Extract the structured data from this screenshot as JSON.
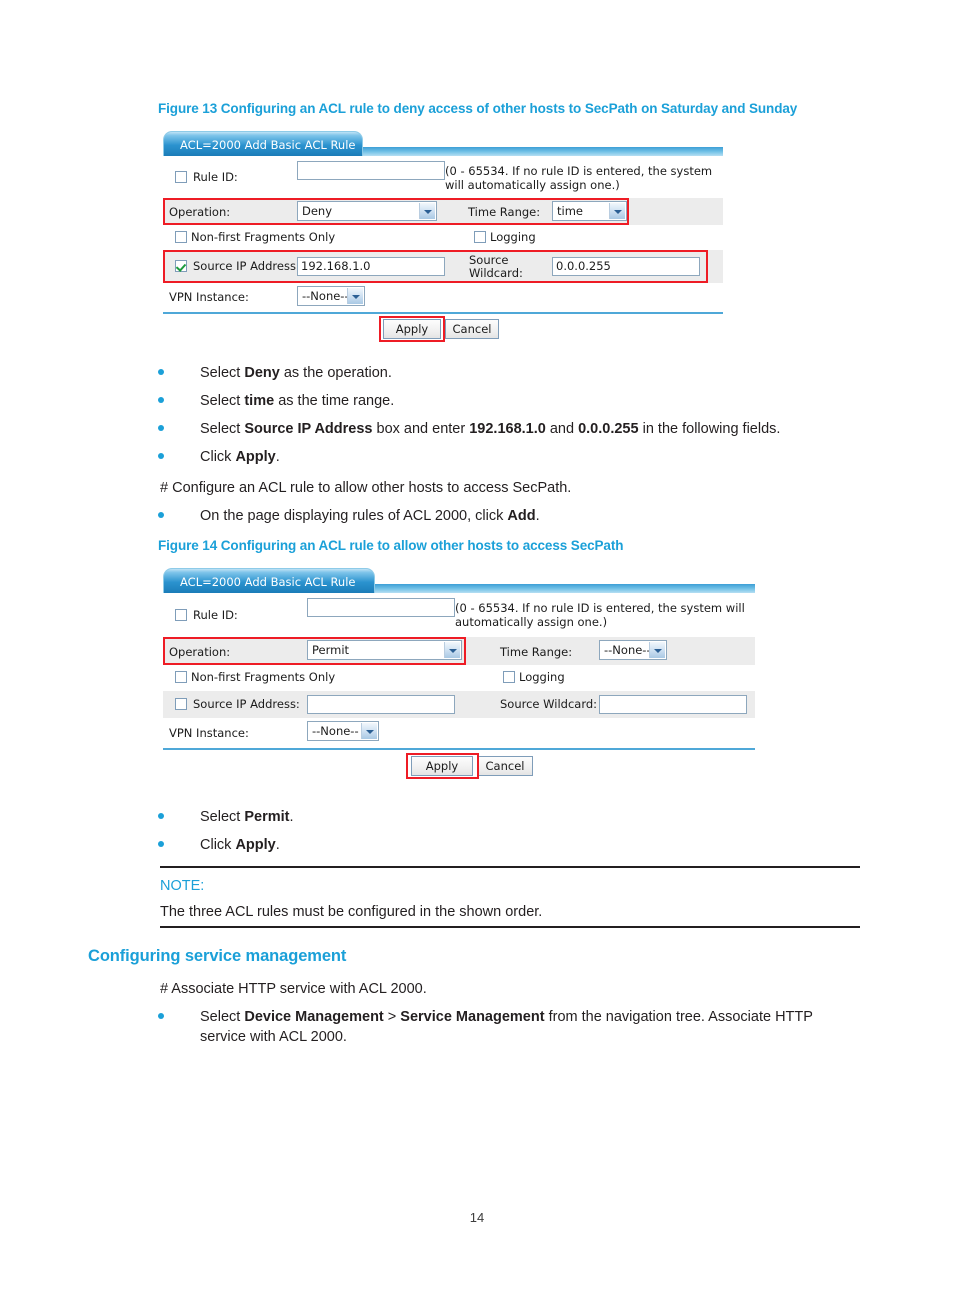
{
  "page": {
    "number": "14"
  },
  "figure13": {
    "caption": "Figure 13 Configuring an ACL rule to deny access of other hosts to SecPath on Saturday and Sunday",
    "tab_label": "ACL=2000 Add Basic ACL Rule",
    "fields": {
      "rule_id_label": "Rule ID:",
      "rule_id_value": "",
      "rule_id_hint": "(0 - 65534. If no rule ID is entered, the system will automatically assign one.)",
      "operation_label": "Operation:",
      "operation_value": "Deny",
      "time_range_label": "Time Range:",
      "time_range_value": "time",
      "non_first_fragments_label": "Non-first Fragments Only",
      "logging_label": "Logging",
      "source_ip_label": "Source IP Address:",
      "source_ip_value": "192.168.1.0",
      "source_wildcard_label": "Source Wildcard:",
      "source_wildcard_value": "0.0.0.255",
      "vpn_instance_label": "VPN Instance:",
      "vpn_instance_value": "--None--"
    },
    "buttons": {
      "apply": "Apply",
      "cancel": "Cancel"
    }
  },
  "steps1": [
    {
      "prefix": "Select ",
      "bold1": "Deny",
      "suffix": " as the operation."
    },
    {
      "prefix": "Select ",
      "bold1": "time",
      "suffix": " as the time range."
    },
    {
      "prefix": "Select ",
      "bold1": "Source IP Address",
      "mid": " box and enter ",
      "bold2": "192.168.1.0",
      "mid2": " and ",
      "bold3": "0.0.0.255",
      "suffix": " in the following fields."
    },
    {
      "prefix": "Click ",
      "bold1": "Apply",
      "suffix": "."
    }
  ],
  "configure_line": "# Configure an ACL rule to allow other hosts to access SecPath.",
  "step_add": {
    "prefix": "On the page displaying rules of ACL 2000, click ",
    "bold1": "Add",
    "suffix": "."
  },
  "figure14": {
    "caption": "Figure 14 Configuring an ACL rule to allow other hosts to access SecPath",
    "tab_label": "ACL=2000 Add Basic ACL Rule",
    "fields": {
      "rule_id_label": "Rule ID:",
      "rule_id_value": "",
      "rule_id_hint": "(0 - 65534. If no rule ID is entered, the system will automatically assign one.)",
      "operation_label": "Operation:",
      "operation_value": "Permit",
      "time_range_label": "Time Range:",
      "time_range_value": "--None--",
      "non_first_fragments_label": "Non-first Fragments Only",
      "logging_label": "Logging",
      "source_ip_label": "Source IP Address:",
      "source_ip_value": "",
      "source_wildcard_label": "Source Wildcard:",
      "source_wildcard_value": "",
      "vpn_instance_label": "VPN Instance:",
      "vpn_instance_value": "--None--"
    },
    "buttons": {
      "apply": "Apply",
      "cancel": "Cancel"
    }
  },
  "steps2": [
    {
      "prefix": "Select ",
      "bold1": "Permit",
      "suffix": "."
    },
    {
      "prefix": "Click ",
      "bold1": "Apply",
      "suffix": "."
    }
  ],
  "note": {
    "label": "NOTE:",
    "body": "The three ACL rules must be configured in the shown order."
  },
  "section": {
    "heading": "Configuring service management",
    "intro": "# Associate HTTP service with ACL 2000.",
    "step": {
      "prefix": "Select ",
      "bold1": "Device Management",
      "mid": " > ",
      "bold2": "Service Management",
      "suffix": " from the navigation tree. Associate HTTP service with ACL 2000."
    }
  },
  "colors": {
    "accent_blue": "#1ba0d8",
    "highlight_red": "#ee1c25",
    "text": "#231f20"
  }
}
